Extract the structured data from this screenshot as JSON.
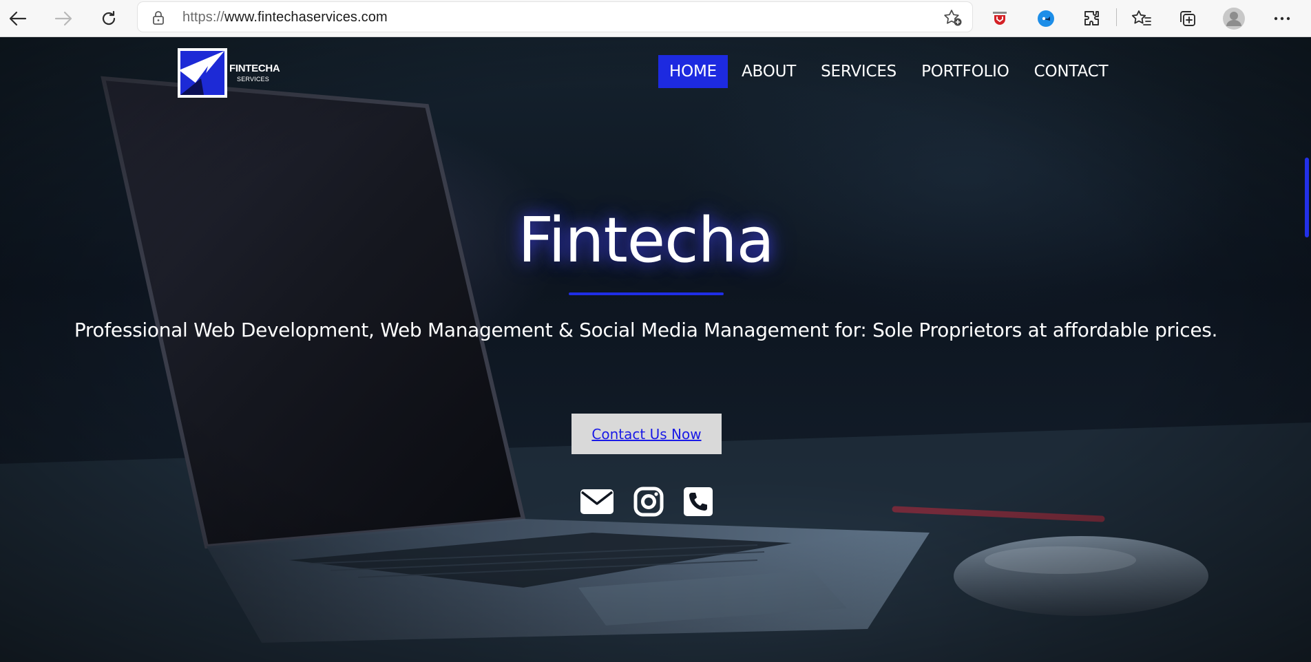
{
  "browser": {
    "url_protocol": "https://",
    "url_host": "www.fintechaservices.com",
    "icons": [
      "back-icon",
      "forward-icon",
      "refresh-icon",
      "lock-icon",
      "add-favorite-icon",
      "extension-red-icon",
      "extension-blue-icon",
      "extensions-icon",
      "favorites-icon",
      "collections-icon",
      "profile-icon",
      "more-icon"
    ]
  },
  "site": {
    "logo_text": "FINTECHA",
    "logo_subtext": "SERVICES",
    "nav": [
      {
        "label": "HOME"
      },
      {
        "label": "ABOUT"
      },
      {
        "label": "SERVICES"
      },
      {
        "label": "PORTFOLIO"
      },
      {
        "label": "CONTACT"
      }
    ],
    "hero_title": "Fintecha",
    "hero_subtitle": "Professional Web Development, Web Management & Social Media Management for: Sole Proprietors at affordable prices.",
    "cta_label": "Contact Us Now",
    "social_icons": [
      "email-icon",
      "instagram-icon",
      "phone-icon"
    ]
  },
  "colors": {
    "accent": "#1d2ae0",
    "cta_bg": "#d9d9d9",
    "cta_text": "#1a1ae6"
  }
}
